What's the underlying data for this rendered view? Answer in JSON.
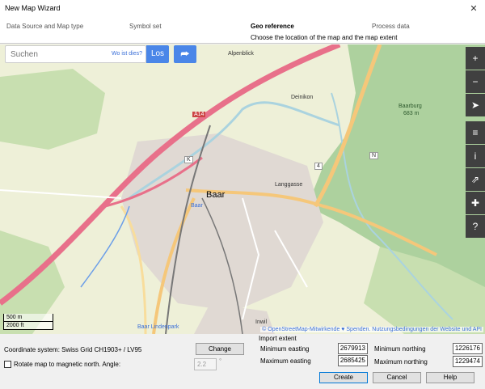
{
  "window": {
    "title": "New Map Wizard",
    "close": "✕"
  },
  "steps": [
    {
      "label": "Data Source and Map type"
    },
    {
      "label": "Symbol set"
    },
    {
      "label": "Geo reference"
    },
    {
      "label": "Process data"
    }
  ],
  "step_subtitle": "Choose the location of the map and the map extent",
  "map": {
    "search_placeholder": "Suchen",
    "search_hint": "Wo ist dies?",
    "go_button": "Los",
    "route_icon": "⮫",
    "tools": [
      {
        "icon": "zoom-in-icon",
        "glyph": "+"
      },
      {
        "icon": "zoom-out-icon",
        "glyph": "−"
      },
      {
        "icon": "locate-icon",
        "glyph": "➤"
      },
      {
        "icon": "layers-icon",
        "glyph": "≡"
      },
      {
        "icon": "info-icon",
        "glyph": "i"
      },
      {
        "icon": "share-icon",
        "glyph": "⇗"
      },
      {
        "icon": "note-icon",
        "glyph": "✚"
      },
      {
        "icon": "query-icon",
        "glyph": "?"
      }
    ],
    "labels": {
      "alpenblick": "Alpenblick",
      "deinikon": "Deinikon",
      "baarburg": "Baarburg",
      "baarburg_elev": "683 m",
      "a14": "A14",
      "baar": "Baar",
      "baar_small": "Baar",
      "langgasse": "Langgasse",
      "inwil": "Inwil",
      "baar_lindenpark": "Baar Lindenpark",
      "route_num": "4",
      "k_marker": "K",
      "n_marker": "N"
    },
    "scale_m": "500 m",
    "scale_ft": "2000 ft",
    "attribution": "© OpenStreetMap-Mitwirkende ♥ Spenden. Nutzungsbedingungen der Website und API"
  },
  "coordinate": {
    "label": "Coordinate system: Swiss Grid  CH1903+ / LV95",
    "change_button": "Change",
    "rotate_label": "Rotate map to magnetic north. Angle:",
    "angle_value": "2.2",
    "angle_unit": "°"
  },
  "extent": {
    "title": "Import extent",
    "min_easting_label": "Minimum easting",
    "min_easting": "2679913",
    "max_easting_label": "Maximum easting",
    "max_easting": "2685425",
    "min_northing_label": "Minimum northing",
    "min_northing": "1226176",
    "max_northing_label": "Maximum northing",
    "max_northing": "1229474"
  },
  "buttons": {
    "create": "Create",
    "cancel": "Cancel",
    "help": "Help"
  },
  "colors": {
    "accent": "#4a86e8",
    "motorway": "#e8708a",
    "main_road": "#f5c77a",
    "forest": "#add19e",
    "water": "#aad3df"
  }
}
